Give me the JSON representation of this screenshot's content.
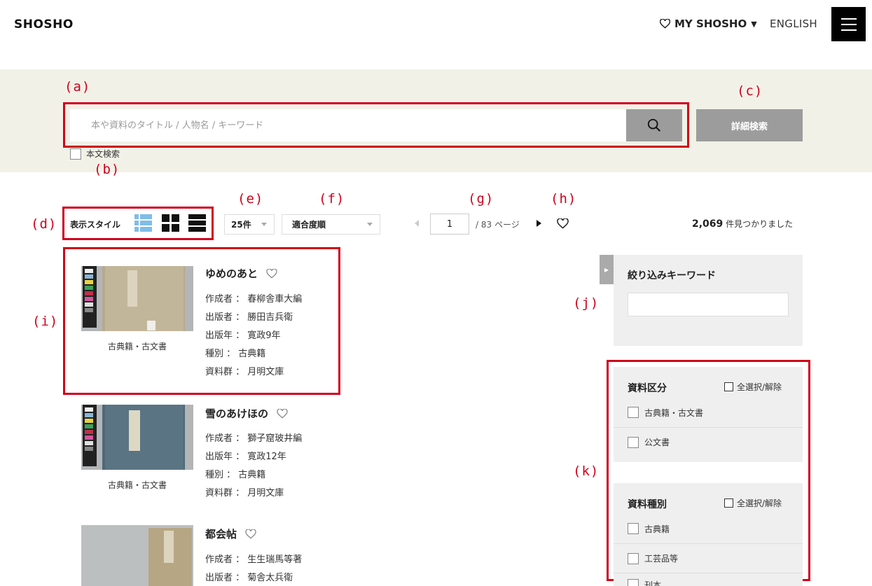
{
  "header": {
    "logo": "SHOSHO",
    "my_shosho": "MY SHOSHO",
    "language": "ENGLISH"
  },
  "search": {
    "placeholder": "本や資料のタイトル / 人物名 / キーワード",
    "advanced_label": "詳細検索",
    "fulltext_label": "本文検索"
  },
  "annotations": {
    "a": "(a)",
    "b": "(b)",
    "c": "(c)",
    "d": "(d)",
    "e": "(e)",
    "f": "(f)",
    "g": "(g)",
    "h": "(h)",
    "i": "(i)",
    "j": "(j)",
    "k": "(k)"
  },
  "toolbar": {
    "display_style_label": "表示スタイル",
    "per_page": "25件",
    "sort": "適合度順",
    "page_current": "1",
    "page_total": "/ 83 ページ",
    "result_count": "2,069",
    "result_suffix": " 件見つかりました"
  },
  "records": [
    {
      "title": "ゆめのあと",
      "category": "古典籍・古文書",
      "meta": [
        "作成者 ： 春柳舎車大編",
        "出版者 ： 勝田吉兵衛",
        "出版年 ： 寛政9年",
        "種別 ： 古典籍",
        "資料群 ： 月明文庫"
      ]
    },
    {
      "title": "雪のあけほの",
      "category": "古典籍・古文書",
      "meta": [
        "作成者 ： 獅子窟玻井編",
        "出版年 ： 寛政12年",
        "種別 ： 古典籍",
        "資料群 ： 月明文庫"
      ]
    },
    {
      "title": "都会帖",
      "category": "",
      "meta": [
        "作成者 ： 生生瑞馬等著",
        "出版者 ： 菊舎太兵衛"
      ]
    }
  ],
  "sidebar": {
    "keyword_title": "絞り込みキーワード",
    "facets": [
      {
        "title": "資料区分",
        "select_all": "全選択/解除",
        "options": [
          "古典籍・古文書",
          "公文書"
        ]
      },
      {
        "title": "資料種別",
        "select_all": "全選択/解除",
        "options": [
          "古典籍",
          "工芸品等",
          "刊本"
        ]
      }
    ]
  }
}
